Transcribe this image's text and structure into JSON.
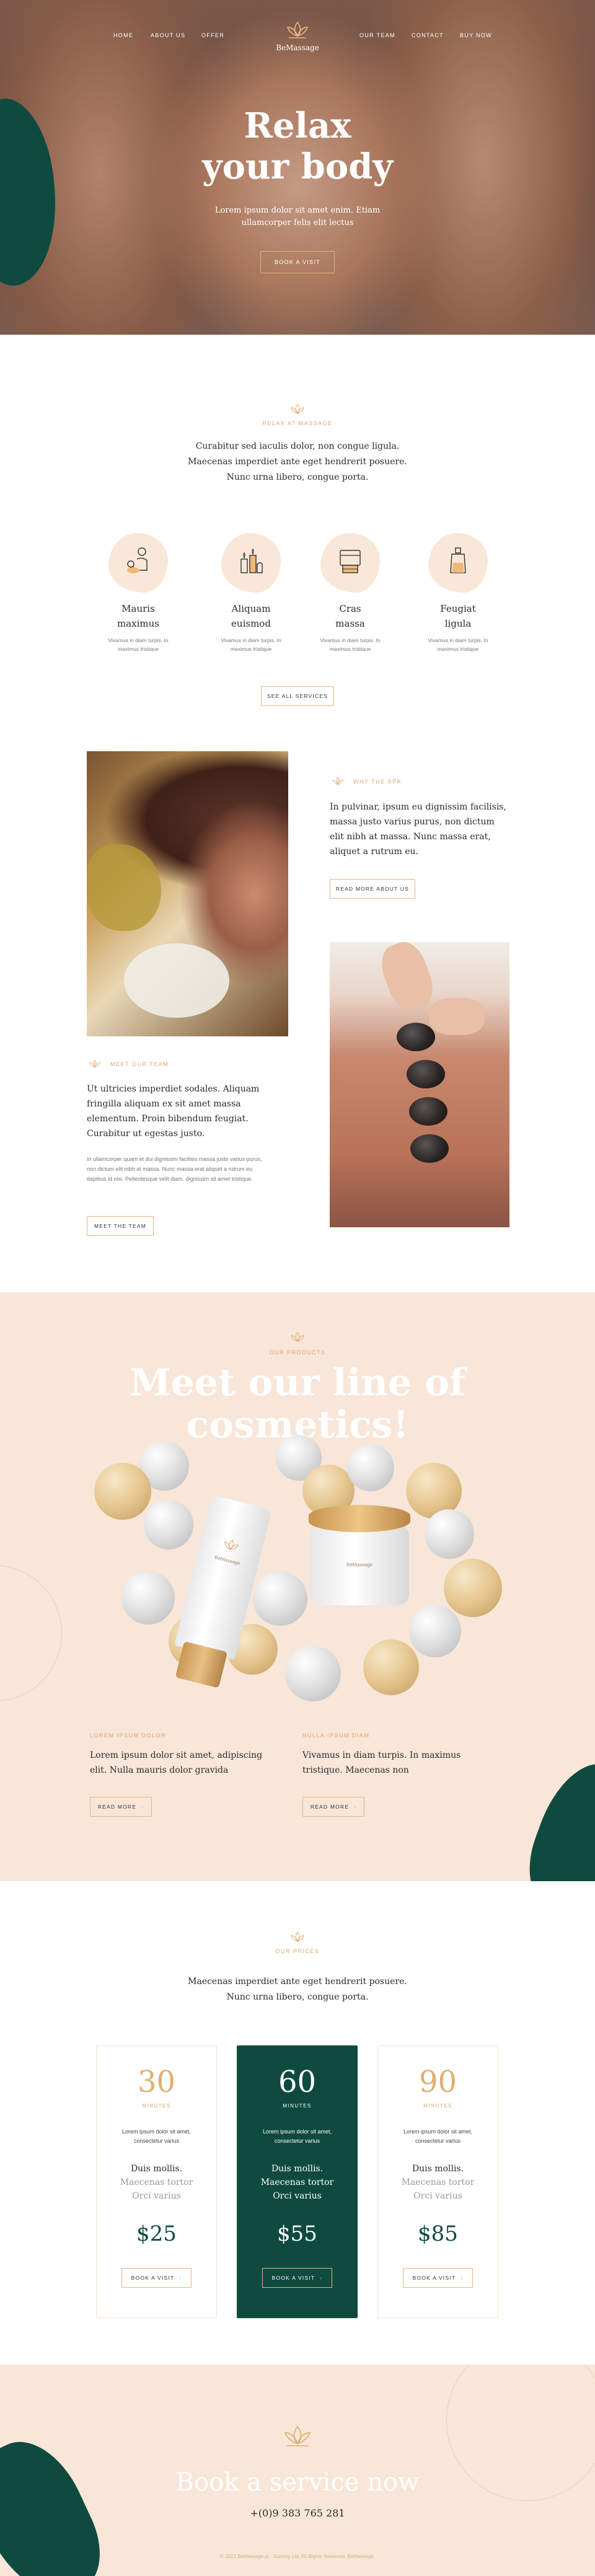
{
  "nav": {
    "items": [
      "Home",
      "About us",
      "Offer",
      "Our team",
      "Contact",
      "Buy now"
    ],
    "logo_text": "BeMassage"
  },
  "hero": {
    "title_line1": "Relax",
    "title_line2": "your body",
    "subtitle": "Lorem ipsum dolor sit amet enim. Etiam ullamcorper felis elit lectus",
    "button": "Book a visit"
  },
  "services": {
    "label": "Relax at Massage",
    "intro": [
      "Curabitur sed iaculis dolor, non congue ligula.",
      "Maecenas imperdiet ante eget hendrerit posuere.",
      "Nunc urna libero, congue porta."
    ],
    "items": [
      {
        "title1": "Mauris",
        "title2": "maximus",
        "icon": "massage-icon",
        "desc1": "Vivamus in diam turpis. In",
        "desc2": "maximus tristique"
      },
      {
        "title1": "Aliquam",
        "title2": "euismod",
        "icon": "candles-icon",
        "desc1": "Vivamus in diam turpis. In",
        "desc2": "maximus tristique"
      },
      {
        "title1": "Cras",
        "title2": "massa",
        "icon": "cosmetics-icon",
        "desc1": "Vivamus in diam turpis. In",
        "desc2": "maximus tristique"
      },
      {
        "title1": "Feugiat",
        "title2": "ligula",
        "icon": "oil-bottle-icon",
        "desc1": "Vivamus in diam turpis. In",
        "desc2": "maximus tristique"
      }
    ],
    "button": "See all services"
  },
  "about": {
    "label": "Why the spa",
    "text": "In pulvinar, ipsum eu dignissim facilisis, massa justo varius purus, non dictum elit nibh at massa. Nunc massa erat, aliquet a rutrum eu.",
    "button": "Read more about us",
    "team_label": "Meet our team",
    "team_text": "Ut ultricies imperdiet sodales. Aliquam fringilla aliquam ex sit amet massa elementum. Proin bibendum feugiat. Curabitur ut egestas justo.",
    "team_small": "In ullamcorper quam et dui dignissim facilisis massa justo varius purus, non dictum elit nibh at massa. Nunc massa erat aliquet a rutrum eu dapibus id nisi. Pellentesque velit diam, dignissim sit amet tristique.",
    "team_button": "Meet the team"
  },
  "cosmetics": {
    "label": "Our products",
    "title_line1": "Meet our line of",
    "title_line2": "cosmetics!",
    "left_label": "Lorem ipsum dolor",
    "left_text": "Lorem ipsum dolor sit amet, adipiscing elit. Nulla mauris dolor gravida",
    "left_button": "Read more",
    "right_label": "Nulla ipsum diam",
    "right_text": "Vivamus in diam turpis. In maximus tristique. Maecenas non",
    "right_button": "Read more",
    "product_label": "BeMassage"
  },
  "pricing": {
    "label": "Our prices",
    "intro": [
      "Maecenas imperdiet ante eget hendrerit posuere.",
      "Nunc urna libero, congue porta."
    ],
    "cards": [
      {
        "minutes": "30",
        "unit": "MINUTES",
        "desc": "Lorem ipsum dolor sit amet, consectetur varius",
        "f1": "Duis mollis.",
        "f2": "Maecenas tortor",
        "f3": "Orci varius",
        "price": "$25",
        "button": "BOOK A VISIT"
      },
      {
        "minutes": "60",
        "unit": "MINUTES",
        "desc": "Lorem ipsum dolor sit amet, consectetur varius",
        "f1": "Duis mollis.",
        "f2": "Maecenas tortor",
        "f3": "Orci varius",
        "price": "$55",
        "button": "BOOK A VISIT"
      },
      {
        "minutes": "90",
        "unit": "MINUTES",
        "desc": "Lorem ipsum dolor sit amet, consectetur varius",
        "f1": "Duis mollis.",
        "f2": "Maecenas tortor",
        "f3": "Orci varius",
        "price": "$85",
        "button": "BOOK A VISIT"
      }
    ]
  },
  "footer": {
    "title": "Book a service now",
    "phone": "+(0)9 383 765 281",
    "copyright": "© 2021 BeMassage.io · Dummy Ltd.  All Rights Reserved. BeMassage."
  },
  "colors": {
    "accent": "#e0ae72",
    "dark_green": "#0f4a3f",
    "peach": "#f8e6d9"
  }
}
